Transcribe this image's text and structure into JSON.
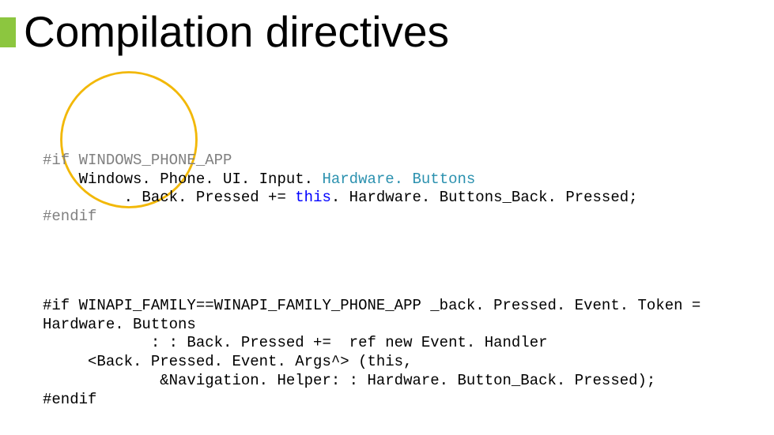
{
  "title": "Compilation directives",
  "code1": {
    "l1a": "#if WINDOWS_PHONE_APP",
    "l2a": "    Windows. Phone. UI. Input. ",
    "l2b": "Hardware. Buttons",
    "l3a": "         . Back. Pressed += ",
    "l3b": "this",
    "l3c": ". Hardware. Buttons_Back. Pressed;",
    "l4a": "#endif"
  },
  "code2": {
    "l1": "#if WINAPI_FAMILY==WINAPI_FAMILY_PHONE_APP _back. Pressed. Event. Token =",
    "l2": "Hardware. Buttons",
    "l3": "            : : Back. Pressed +=  ref new Event. Handler",
    "l4": "     <Back. Pressed. Event. Args^> (this,",
    "l5": "             &Navigation. Helper: : Hardware. Button_Back. Pressed);",
    "l6": "#endif"
  }
}
